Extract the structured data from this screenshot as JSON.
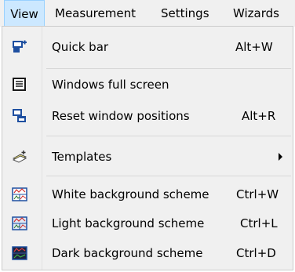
{
  "menubar": {
    "items": [
      {
        "label": "View"
      },
      {
        "label": "Measurement"
      },
      {
        "label": "Settings"
      },
      {
        "label": "Wizards"
      }
    ]
  },
  "menu": {
    "items": [
      {
        "label": "Quick bar",
        "shortcut": "Alt+W",
        "icon": "quick-bar-icon"
      },
      {
        "label": "Windows full screen",
        "shortcut": "",
        "icon": "full-screen-icon"
      },
      {
        "label": "Reset window positions",
        "shortcut": "Alt+R",
        "icon": "reset-windows-icon"
      },
      {
        "label": "Templates",
        "shortcut": "",
        "icon": "templates-icon",
        "submenu": true
      },
      {
        "label": "White background scheme",
        "shortcut": "Ctrl+W",
        "icon": "white-scheme-icon"
      },
      {
        "label": "Light background scheme",
        "shortcut": "Ctrl+L",
        "icon": "light-scheme-icon"
      },
      {
        "label": "Dark background scheme",
        "shortcut": "Ctrl+D",
        "icon": "dark-scheme-icon"
      }
    ]
  },
  "colors": {
    "menubar_bg": "#f0f0f0",
    "active_bg": "#cce8ff",
    "active_border": "#99d1ff",
    "icon_blue": "#1e4fa0",
    "icon_dark": "#1a1a1a"
  }
}
